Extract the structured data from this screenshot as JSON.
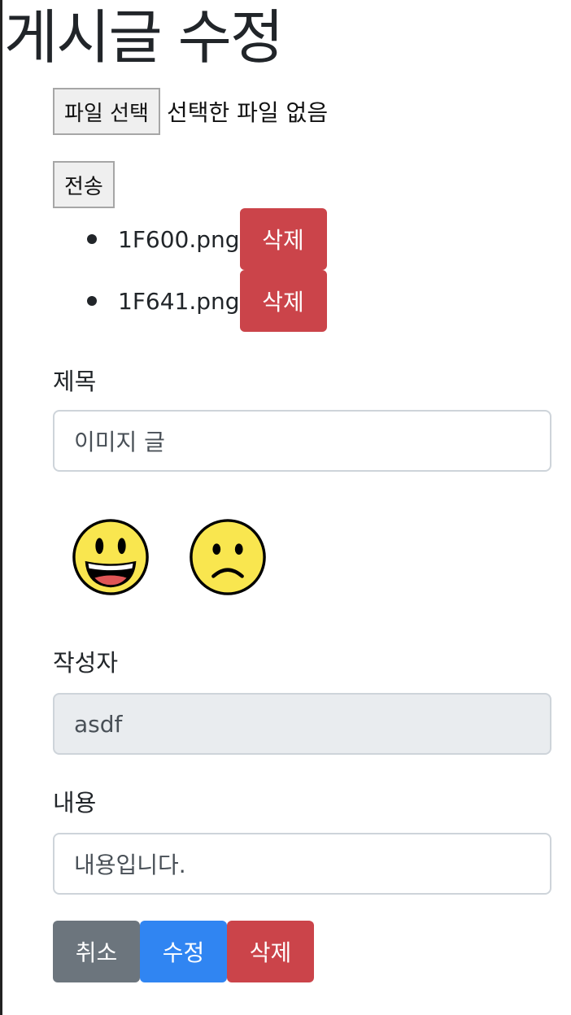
{
  "page": {
    "title": "게시글 수정"
  },
  "file_input": {
    "choose_label": "파일 선택",
    "status": "선택한 파일 없음"
  },
  "submit_label": "전송",
  "attachments": [
    {
      "name": "1F600.png",
      "delete_label": "삭제",
      "emoji": "grinning-face"
    },
    {
      "name": "1F641.png",
      "delete_label": "삭제",
      "emoji": "slightly-frowning-face"
    }
  ],
  "form": {
    "title_label": "제목",
    "title_value": "이미지 글",
    "author_label": "작성자",
    "author_value": "asdf",
    "content_label": "내용",
    "content_value": "내용입니다."
  },
  "actions": {
    "cancel_label": "취소",
    "edit_label": "수정",
    "delete_label": "삭제"
  },
  "colors": {
    "danger": "#cb444a",
    "primary": "#3085f2",
    "secondary": "#6c757d",
    "readonly_bg": "#e9ecef",
    "emoji_yellow": "#f9e64f"
  }
}
